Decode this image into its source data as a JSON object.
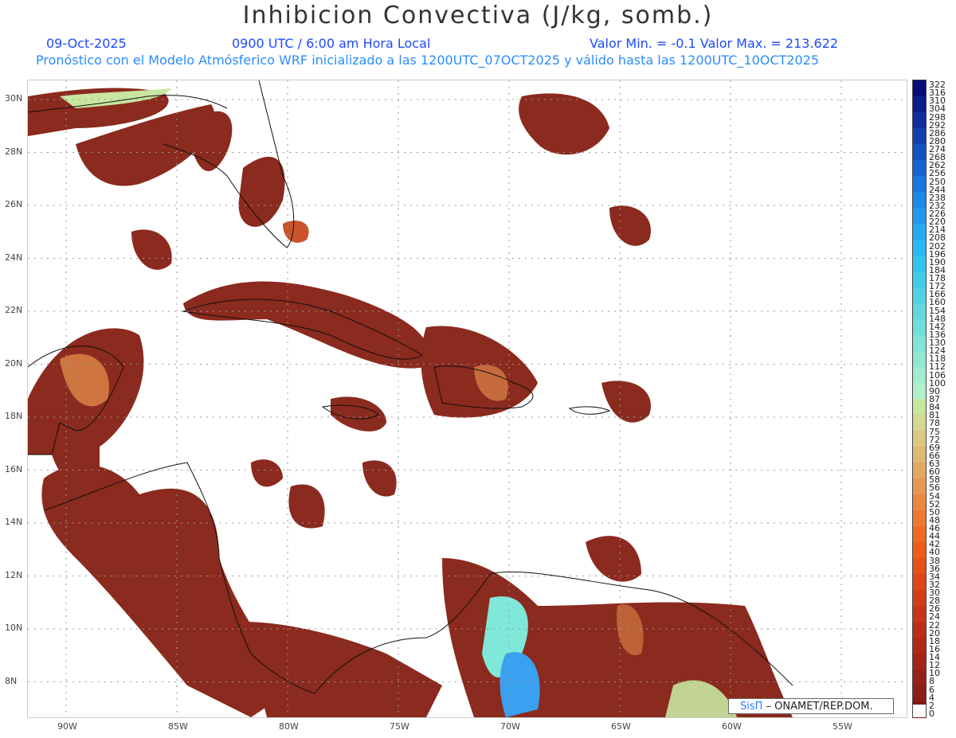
{
  "title": "Inhibicion Convectiva (J/kg, somb.)",
  "header": {
    "date": "09-Oct-2025",
    "time": "0900 UTC / 6:00 am Hora Local",
    "minmax": "Valor Min. = -0.1  Valor Max. = 213.622",
    "subtitle": "Pronóstico con el Modelo Atmósferico WRF inicializado a las 1200UTC_07OCT2025 y válido hasta las  1200UTC_10OCT2025"
  },
  "map": {
    "lat_labels": [
      "30N",
      "28N",
      "26N",
      "24N",
      "22N",
      "20N",
      "18N",
      "16N",
      "14N",
      "12N",
      "10N",
      "8N"
    ],
    "lon_labels": [
      "90W",
      "85W",
      "80W",
      "75W",
      "70W",
      "65W",
      "60W",
      "55W"
    ],
    "colors": {
      "cin_low": "#8b2a1e",
      "cin_mid": "#c8552a",
      "cin_high": "#e08848",
      "cin_green": "#c8e6a0",
      "cin_cyan": "#7fe8d8",
      "cin_blue": "#3aa0f0",
      "coast": "#111111",
      "grid": "#9a9a9a"
    }
  },
  "colorbar": {
    "labels": [
      "322",
      "316",
      "310",
      "304",
      "298",
      "292",
      "286",
      "280",
      "274",
      "268",
      "262",
      "256",
      "250",
      "244",
      "238",
      "232",
      "226",
      "220",
      "214",
      "208",
      "202",
      "196",
      "190",
      "184",
      "178",
      "172",
      "166",
      "160",
      "154",
      "148",
      "142",
      "136",
      "130",
      "124",
      "118",
      "112",
      "106",
      "100",
      "90",
      "87",
      "84",
      "81",
      "78",
      "75",
      "72",
      "69",
      "66",
      "63",
      "60",
      "58",
      "56",
      "54",
      "52",
      "50",
      "48",
      "46",
      "44",
      "42",
      "40",
      "38",
      "36",
      "34",
      "32",
      "30",
      "28",
      "26",
      "24",
      "22",
      "20",
      "18",
      "16",
      "14",
      "12",
      "10",
      "8",
      "6",
      "4",
      "2",
      "0"
    ]
  },
  "credit": {
    "logo": "SisΠ",
    "text": " – ONAMET/REP.DOM."
  }
}
